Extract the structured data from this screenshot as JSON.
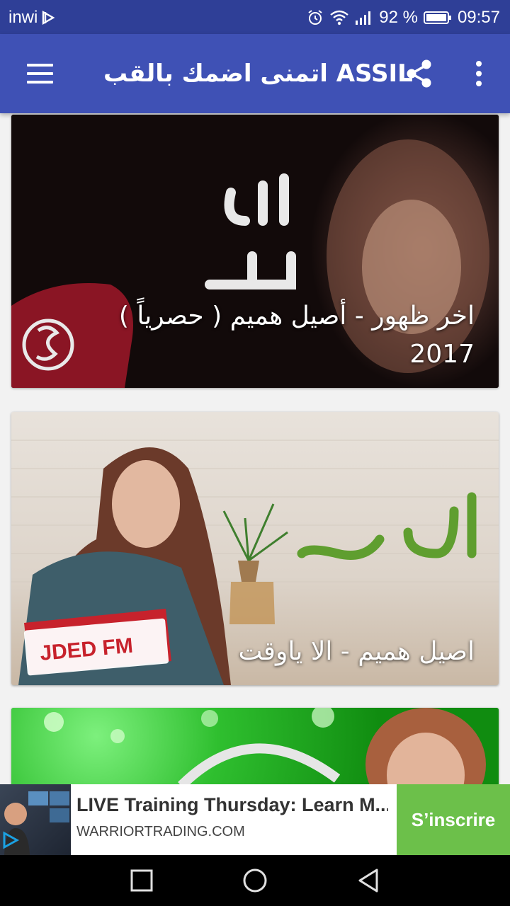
{
  "status_bar": {
    "carrier": "inwi",
    "battery": "92 %",
    "time": "09:57",
    "icons": [
      "nfc-icon",
      "alarm-icon",
      "wifi-icon",
      "signal-icon",
      "battery-icon"
    ]
  },
  "app_bar": {
    "title": "اتمنى اضمك بالقب ASSIL",
    "background": "#3f51b5",
    "menu_icon": "hamburger-icon",
    "share_icon": "share-icon",
    "overflow_icon": "more-vert-icon"
  },
  "cards": [
    {
      "caption": "اخر ظهور - أصيل هميم ( حصرياً ) 2017"
    },
    {
      "caption": "اصيل هميم - الا ياوقت"
    },
    {
      "caption": ""
    }
  ],
  "ad": {
    "headline": "LIVE Training Thursday: Learn M...",
    "domain": "WARRIORTRADING.COM",
    "cta": "S’inscrire",
    "cta_color": "#6cc04a",
    "icon": "ad-choices-icon"
  },
  "nav_bar": {
    "icons": [
      "recents-icon",
      "home-icon",
      "back-icon"
    ]
  }
}
